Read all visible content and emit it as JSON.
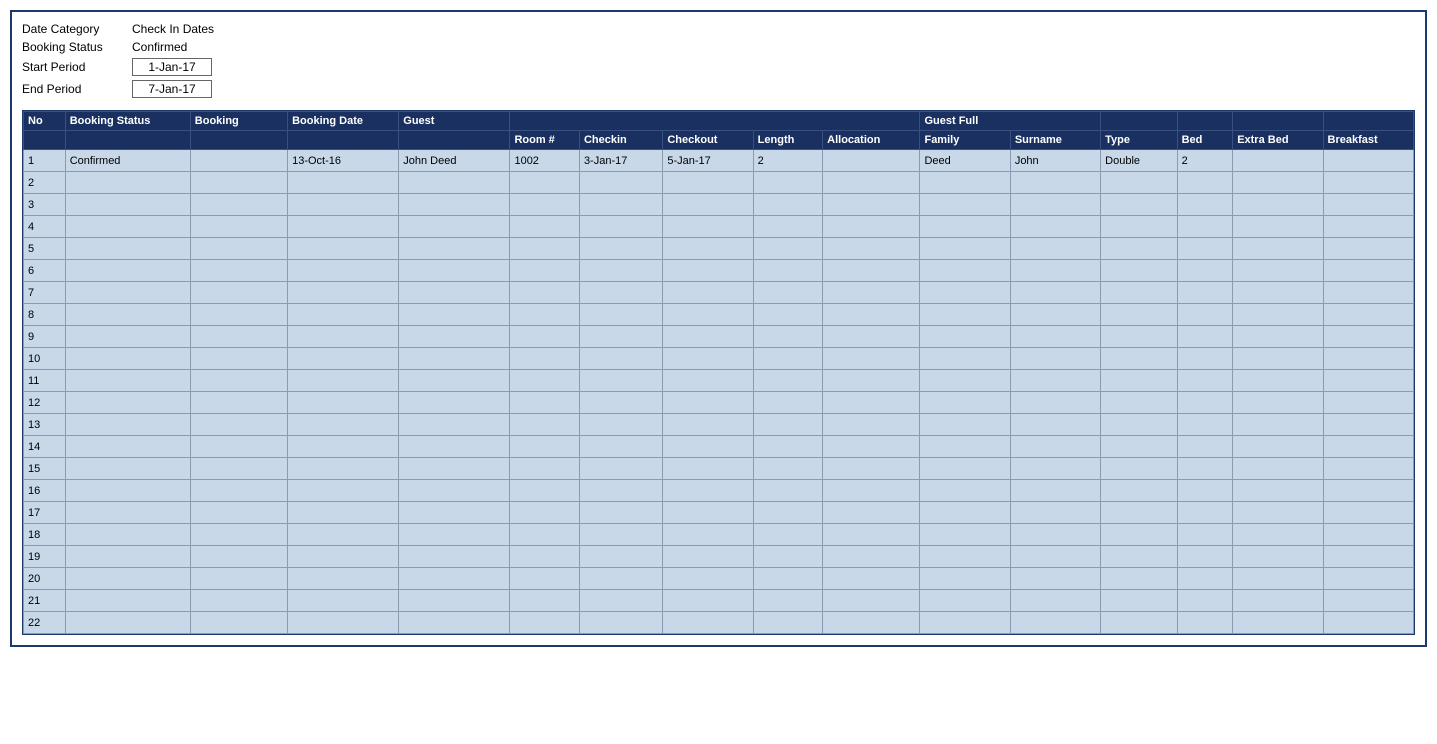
{
  "filters": {
    "date_category_label": "Date Category",
    "date_category_value": "Check In Dates",
    "booking_status_label": "Booking Status",
    "booking_status_value": "Confirmed",
    "start_period_label": "Start Period",
    "start_period_value": "1-Jan-17",
    "end_period_label": "End Period",
    "end_period_value": "7-Jan-17"
  },
  "table": {
    "headers_row1": {
      "no": "No",
      "booking_status": "Booking Status",
      "booking": "Booking",
      "booking_date": "Booking Date",
      "guest": "Guest",
      "guest_full": "Guest Full",
      "spacer_room": "Room #",
      "spacer_checkin": "Checkin",
      "spacer_checkout": "Checkout",
      "spacer_length": "Length",
      "spacer_allocation": "Allocation",
      "family": "Family",
      "surname": "Surname",
      "type": "Type",
      "bed": "Bed",
      "extra_bed": "Extra Bed",
      "breakfast": "Breakfast"
    },
    "rows": [
      {
        "no": "1",
        "booking_status": "Confirmed",
        "booking": "",
        "booking_date": "13-Oct-16",
        "guest": "John Deed",
        "room": "1002",
        "checkin": "3-Jan-17",
        "checkout": "5-Jan-17",
        "length": "2",
        "allocation": "",
        "family": "Deed",
        "surname": "John",
        "type": "Double",
        "bed": "2",
        "extra_bed": "",
        "breakfast": ""
      },
      {
        "no": "2",
        "booking_status": "",
        "booking": "",
        "booking_date": "",
        "guest": "",
        "room": "",
        "checkin": "",
        "checkout": "",
        "length": "",
        "allocation": "",
        "family": "",
        "surname": "",
        "type": "",
        "bed": "",
        "extra_bed": "",
        "breakfast": ""
      },
      {
        "no": "3",
        "booking_status": "",
        "booking": "",
        "booking_date": "",
        "guest": "",
        "room": "",
        "checkin": "",
        "checkout": "",
        "length": "",
        "allocation": "",
        "family": "",
        "surname": "",
        "type": "",
        "bed": "",
        "extra_bed": "",
        "breakfast": ""
      },
      {
        "no": "4",
        "booking_status": "",
        "booking": "",
        "booking_date": "",
        "guest": "",
        "room": "",
        "checkin": "",
        "checkout": "",
        "length": "",
        "allocation": "",
        "family": "",
        "surname": "",
        "type": "",
        "bed": "",
        "extra_bed": "",
        "breakfast": ""
      },
      {
        "no": "5",
        "booking_status": "",
        "booking": "",
        "booking_date": "",
        "guest": "",
        "room": "",
        "checkin": "",
        "checkout": "",
        "length": "",
        "allocation": "",
        "family": "",
        "surname": "",
        "type": "",
        "bed": "",
        "extra_bed": "",
        "breakfast": ""
      },
      {
        "no": "6",
        "booking_status": "",
        "booking": "",
        "booking_date": "",
        "guest": "",
        "room": "",
        "checkin": "",
        "checkout": "",
        "length": "",
        "allocation": "",
        "family": "",
        "surname": "",
        "type": "",
        "bed": "",
        "extra_bed": "",
        "breakfast": ""
      },
      {
        "no": "7",
        "booking_status": "",
        "booking": "",
        "booking_date": "",
        "guest": "",
        "room": "",
        "checkin": "",
        "checkout": "",
        "length": "",
        "allocation": "",
        "family": "",
        "surname": "",
        "type": "",
        "bed": "",
        "extra_bed": "",
        "breakfast": ""
      },
      {
        "no": "8",
        "booking_status": "",
        "booking": "",
        "booking_date": "",
        "guest": "",
        "room": "",
        "checkin": "",
        "checkout": "",
        "length": "",
        "allocation": "",
        "family": "",
        "surname": "",
        "type": "",
        "bed": "",
        "extra_bed": "",
        "breakfast": ""
      },
      {
        "no": "9",
        "booking_status": "",
        "booking": "",
        "booking_date": "",
        "guest": "",
        "room": "",
        "checkin": "",
        "checkout": "",
        "length": "",
        "allocation": "",
        "family": "",
        "surname": "",
        "type": "",
        "bed": "",
        "extra_bed": "",
        "breakfast": ""
      },
      {
        "no": "10",
        "booking_status": "",
        "booking": "",
        "booking_date": "",
        "guest": "",
        "room": "",
        "checkin": "",
        "checkout": "",
        "length": "",
        "allocation": "",
        "family": "",
        "surname": "",
        "type": "",
        "bed": "",
        "extra_bed": "",
        "breakfast": ""
      },
      {
        "no": "11",
        "booking_status": "",
        "booking": "",
        "booking_date": "",
        "guest": "",
        "room": "",
        "checkin": "",
        "checkout": "",
        "length": "",
        "allocation": "",
        "family": "",
        "surname": "",
        "type": "",
        "bed": "",
        "extra_bed": "",
        "breakfast": ""
      },
      {
        "no": "12",
        "booking_status": "",
        "booking": "",
        "booking_date": "",
        "guest": "",
        "room": "",
        "checkin": "",
        "checkout": "",
        "length": "",
        "allocation": "",
        "family": "",
        "surname": "",
        "type": "",
        "bed": "",
        "extra_bed": "",
        "breakfast": ""
      },
      {
        "no": "13",
        "booking_status": "",
        "booking": "",
        "booking_date": "",
        "guest": "",
        "room": "",
        "checkin": "",
        "checkout": "",
        "length": "",
        "allocation": "",
        "family": "",
        "surname": "",
        "type": "",
        "bed": "",
        "extra_bed": "",
        "breakfast": ""
      },
      {
        "no": "14",
        "booking_status": "",
        "booking": "",
        "booking_date": "",
        "guest": "",
        "room": "",
        "checkin": "",
        "checkout": "",
        "length": "",
        "allocation": "",
        "family": "",
        "surname": "",
        "type": "",
        "bed": "",
        "extra_bed": "",
        "breakfast": ""
      },
      {
        "no": "15",
        "booking_status": "",
        "booking": "",
        "booking_date": "",
        "guest": "",
        "room": "",
        "checkin": "",
        "checkout": "",
        "length": "",
        "allocation": "",
        "family": "",
        "surname": "",
        "type": "",
        "bed": "",
        "extra_bed": "",
        "breakfast": ""
      },
      {
        "no": "16",
        "booking_status": "",
        "booking": "",
        "booking_date": "",
        "guest": "",
        "room": "",
        "checkin": "",
        "checkout": "",
        "length": "",
        "allocation": "",
        "family": "",
        "surname": "",
        "type": "",
        "bed": "",
        "extra_bed": "",
        "breakfast": ""
      },
      {
        "no": "17",
        "booking_status": "",
        "booking": "",
        "booking_date": "",
        "guest": "",
        "room": "",
        "checkin": "",
        "checkout": "",
        "length": "",
        "allocation": "",
        "family": "",
        "surname": "",
        "type": "",
        "bed": "",
        "extra_bed": "",
        "breakfast": ""
      },
      {
        "no": "18",
        "booking_status": "",
        "booking": "",
        "booking_date": "",
        "guest": "",
        "room": "",
        "checkin": "",
        "checkout": "",
        "length": "",
        "allocation": "",
        "family": "",
        "surname": "",
        "type": "",
        "bed": "",
        "extra_bed": "",
        "breakfast": ""
      },
      {
        "no": "19",
        "booking_status": "",
        "booking": "",
        "booking_date": "",
        "guest": "",
        "room": "",
        "checkin": "",
        "checkout": "",
        "length": "",
        "allocation": "",
        "family": "",
        "surname": "",
        "type": "",
        "bed": "",
        "extra_bed": "",
        "breakfast": ""
      },
      {
        "no": "20",
        "booking_status": "",
        "booking": "",
        "booking_date": "",
        "guest": "",
        "room": "",
        "checkin": "",
        "checkout": "",
        "length": "",
        "allocation": "",
        "family": "",
        "surname": "",
        "type": "",
        "bed": "",
        "extra_bed": "",
        "breakfast": ""
      },
      {
        "no": "21",
        "booking_status": "",
        "booking": "",
        "booking_date": "",
        "guest": "",
        "room": "",
        "checkin": "",
        "checkout": "",
        "length": "",
        "allocation": "",
        "family": "",
        "surname": "",
        "type": "",
        "bed": "",
        "extra_bed": "",
        "breakfast": ""
      },
      {
        "no": "22",
        "booking_status": "",
        "booking": "",
        "booking_date": "",
        "guest": "",
        "room": "",
        "checkin": "",
        "checkout": "",
        "length": "",
        "allocation": "",
        "family": "",
        "surname": "",
        "type": "",
        "bed": "",
        "extra_bed": "",
        "breakfast": ""
      }
    ]
  }
}
